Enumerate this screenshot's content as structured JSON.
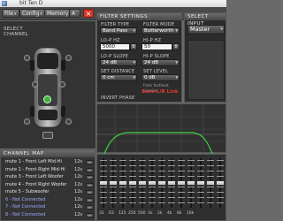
{
  "window": {
    "title": "bit Ten D"
  },
  "toolbar": {
    "file": "File",
    "config": "Config",
    "memory": "Memory",
    "memory_slot": "A",
    "close": "×"
  },
  "channel_panel": {
    "title": "Select Channel"
  },
  "filter_settings": {
    "title": "Filter Settings",
    "filter_type_label": "Filter Type",
    "filter_type_value": "Band Pass",
    "filter_mode_label": "Filter Mode",
    "filter_mode_value": "Butterworth",
    "lo_p_hz_label": "Lo-P Hz",
    "lo_p_hz_value": "5000",
    "hi_p_hz_label": "Hi-P Hz",
    "hi_p_hz_value": "50",
    "lo_p_slope_label": "Lo-P Slope",
    "lo_p_slope_value": "24 dB",
    "hi_p_slope_label": "Hi-P Slope",
    "hi_p_slope_value": "24 dB",
    "set_distance_label": "Set Distance",
    "set_distance_value": "0 cm",
    "set_level_label": "Set Level",
    "set_level_value": "0 dB",
    "link_note": "from farthest speaker",
    "save_link": "Save L/R Link",
    "invert_phase": "Invert Phase"
  },
  "select_input": {
    "title": "Select Input",
    "value": "Master"
  },
  "channel_map": {
    "title": "Channel Map",
    "rows": [
      {
        "name": "mute 1 - Front Left Mid-Hi",
        "time": "12s",
        "del": "ch"
      },
      {
        "name": "mute 1 - Front Right Mid-Hi",
        "time": "12s",
        "del": "ch"
      },
      {
        "name": "mute 3 - Front Left Woofer",
        "time": "12s",
        "del": "ch"
      },
      {
        "name": "mute 4 - Front Right Woofer",
        "time": "12s",
        "del": "ch"
      },
      {
        "name": "mute 5 - Subwoofer",
        "time": "12s",
        "del": "ch"
      },
      {
        "name": "6 - Not Connected",
        "time": "12s",
        "del": "ch"
      },
      {
        "name": "7 - Not Connected",
        "time": "12s",
        "del": "ch"
      },
      {
        "name": "8 - Not Connected",
        "time": "12s",
        "del": "ch"
      }
    ]
  },
  "eq": {
    "bands": [
      {
        "label": "31",
        "gain": 0
      },
      {
        "label": "63",
        "gain": 0
      },
      {
        "label": "125",
        "gain": 0
      },
      {
        "label": "250",
        "gain": 0
      },
      {
        "label": "500",
        "gain": 0
      },
      {
        "label": "1k",
        "gain": 0
      },
      {
        "label": "2k",
        "gain": 0
      },
      {
        "label": "4k",
        "gain": 0
      },
      {
        "label": "8k",
        "gain": 0
      },
      {
        "label": "16k",
        "gain": 0
      },
      {
        "label": "",
        "gain": 0
      },
      {
        "label": "",
        "gain": 0
      },
      {
        "label": "",
        "gain": 0
      }
    ]
  },
  "colors": {
    "accent_red": "#e63b2e",
    "curve_green": "#3fcf3f",
    "channel_highlight": "#3fb23f",
    "panel_bg": "#2c2c2c"
  }
}
